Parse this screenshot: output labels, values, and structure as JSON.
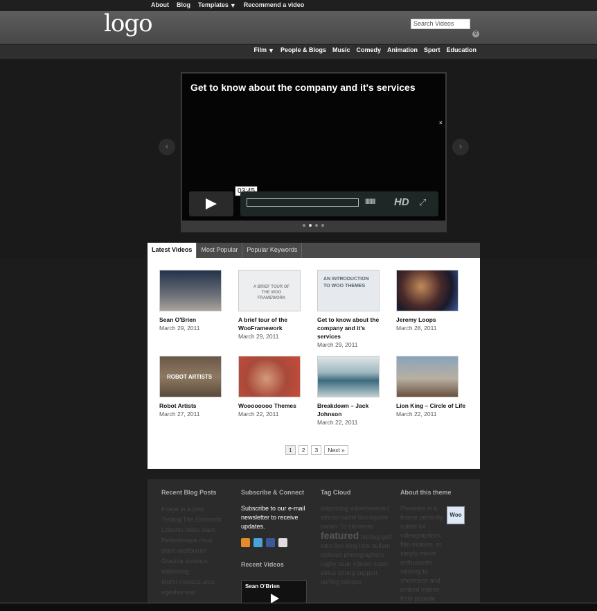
{
  "topnav": {
    "items": [
      "About",
      "Blog",
      "Templates",
      "Recommend a video"
    ]
  },
  "header": {
    "logo": "logo",
    "search_placeholder": "Search Videos"
  },
  "categories": [
    "Film",
    "People & Blogs",
    "Music",
    "Comedy",
    "Animation",
    "Sport",
    "Education"
  ],
  "featured": {
    "title": "Get to know about the company and it's services",
    "timecode": "03:45",
    "hd_label": "HD",
    "close": "×",
    "prev": "‹",
    "next": "›"
  },
  "tabs": [
    "Latest Videos",
    "Most Popular",
    "Popular Keywords"
  ],
  "videos": [
    {
      "title": "Sean O'Brien",
      "date": "March 29, 2011",
      "thumb_text": ""
    },
    {
      "title": "A brief tour of the WooFramework",
      "date": "March 29, 2011",
      "thumb_text": "A BRIEF TOUR OF THE WOO FRAMEWORK"
    },
    {
      "title": "Get to know about the company and it's services",
      "date": "March 29, 2011",
      "thumb_text": "AN INTRODUCTION TO WOO THEMES"
    },
    {
      "title": "Jeremy Loops",
      "date": "March 28, 2011",
      "thumb_text": ""
    },
    {
      "title": "Robot Artists",
      "date": "March 27, 2011",
      "thumb_text": "ROBOT ARTISTS"
    },
    {
      "title": "Woooooooo Themes",
      "date": "March 22, 2011",
      "thumb_text": ""
    },
    {
      "title": "Breakdown – Jack Johnson",
      "date": "March 22, 2011",
      "thumb_text": ""
    },
    {
      "title": "Lion King – Circle of Life",
      "date": "March 22, 2011",
      "thumb_text": ""
    }
  ],
  "pager": [
    "1",
    "2",
    "3",
    "Next »"
  ],
  "footer": {
    "blog": {
      "heading": "Recent Blog Posts",
      "items": [
        "Image in a post",
        "Testing The Elements",
        "Lobortis tellus diam",
        "Pellentesque risus",
        "diam vestibulum",
        "Gravida vivamus",
        "adipiscing",
        "Morbi rhoncus arcu",
        "egestas erat"
      ]
    },
    "subscribe": {
      "heading": "Subscribe & Connect",
      "text": "Subscribe to our e-mail newsletter to receive updates.",
      "recent_heading": "Recent Videos",
      "recent_title": "Sean O'Brien"
    },
    "tags": {
      "heading": "Tag Cloud",
      "before": "adipiscing advertisement african cartel blockquote canon 7d elements",
      "featured": "featured",
      "after": "firebug golf intro lion king lists nullam ordered photographers rugby sean o'brien south africa strong support surfing tempus"
    },
    "about": {
      "heading": "About this theme",
      "text": "Premiere is a theme perfectly suited for videographers, film-makers, or simply movie enthusiasts wishing to showcase and embed videos from popular sites like Vimeo, YouTube, etc.",
      "badge": "Woo"
    }
  },
  "colors": {
    "background": "#1c1c1c",
    "header": "#535353",
    "panel": "#ffffff",
    "footer": "#2b2b2b"
  }
}
